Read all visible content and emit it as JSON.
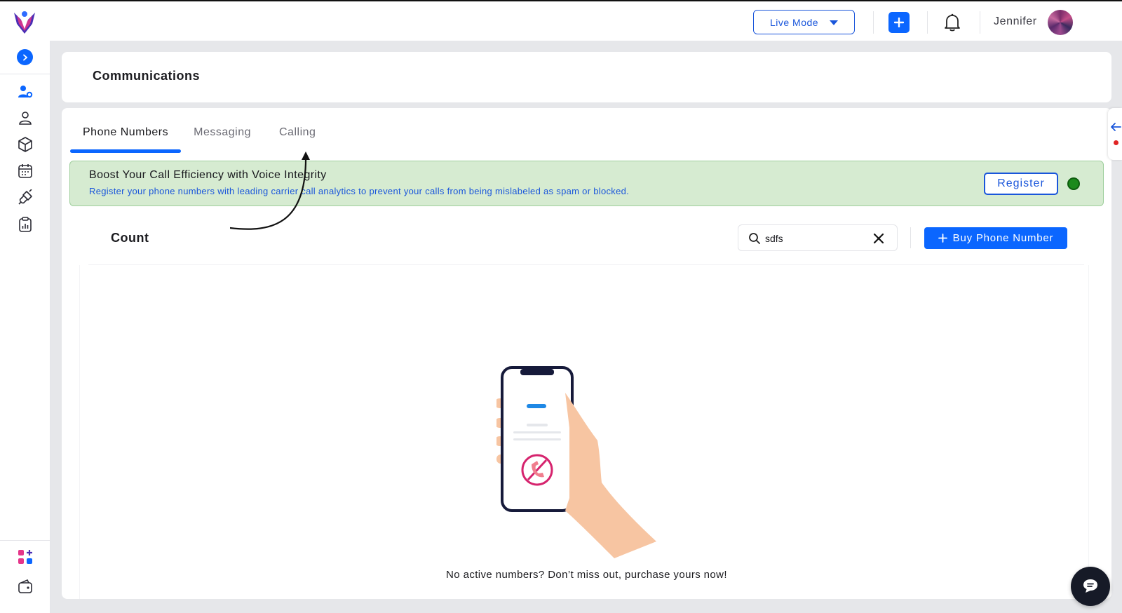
{
  "topbar": {
    "mode_label": "Live Mode",
    "user_name": "Jennifer"
  },
  "header": {
    "title": "Communications"
  },
  "tabs": [
    {
      "label": "Phone Numbers",
      "active": true
    },
    {
      "label": "Messaging",
      "active": false
    },
    {
      "label": "Calling",
      "active": false
    }
  ],
  "banner": {
    "title": "Boost Your Call Efficiency with Voice Integrity",
    "text": "Register your phone numbers with leading carrier call analytics to prevent your calls from being mislabeled as spam or blocked.",
    "register_label": "Register",
    "status_color": "#1c8a1c"
  },
  "list": {
    "title": "Count",
    "search_value": "sdfs",
    "buy_label": "Buy Phone Number",
    "empty_message": "No active numbers? Don’t miss out, purchase yours now!"
  },
  "colors": {
    "accent": "#0b66ff",
    "banner_bg": "#d6ebd1",
    "banner_link": "#1a56db"
  },
  "icons": {
    "sidebar": [
      "user-settings-icon",
      "user-icon",
      "box-icon",
      "calendar-icon",
      "integration-icon",
      "report-icon",
      "apps-icon",
      "wallet-icon"
    ]
  }
}
